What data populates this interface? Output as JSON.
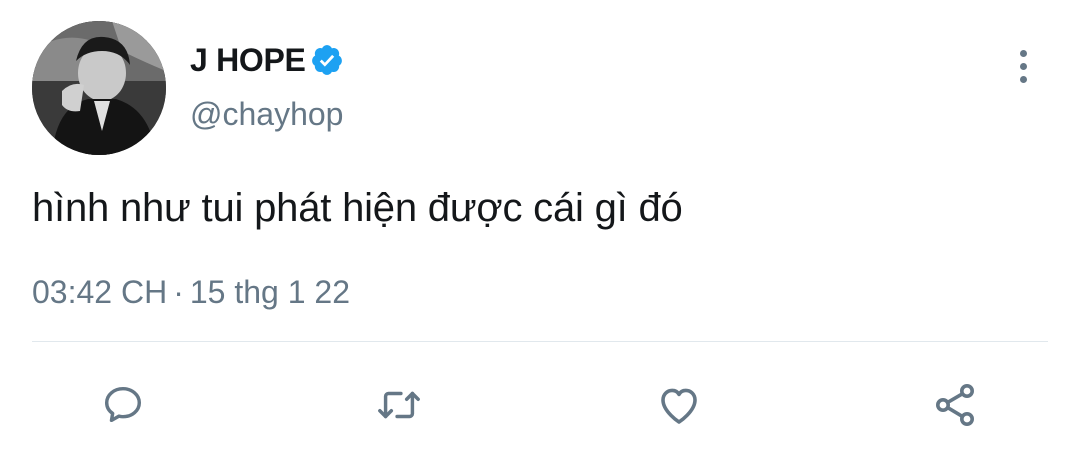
{
  "tweet": {
    "display_name": "J HOPE",
    "handle": "@chayhop",
    "text": "hình như tui phát hiện được cái gì đó",
    "time": "03:42 CH",
    "separator": "·",
    "date": "15 thg 1 22",
    "verified": true
  },
  "icons": {
    "verified": "verified-badge-icon",
    "menu": "more-vertical-icon",
    "reply": "reply-icon",
    "retweet": "retweet-icon",
    "like": "heart-icon",
    "share": "share-icon"
  },
  "colors": {
    "accent": "#1da1f2",
    "text": "#14171a",
    "secondary": "#657786",
    "divider": "#e1e8ed"
  }
}
